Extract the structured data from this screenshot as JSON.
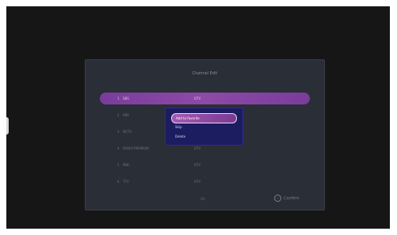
{
  "panel": {
    "title": "Channel Edit",
    "channels": [
      {
        "num": "1",
        "name": "SBS",
        "type": "DTV",
        "selected": true
      },
      {
        "num": "2",
        "name": "KBS",
        "type": "DTV",
        "selected": false
      },
      {
        "num": "3",
        "name": "NCTV",
        "type": "DTV",
        "selected": false
      },
      {
        "num": "4",
        "name": "RADIO PREMIUM",
        "type": "DTV",
        "selected": false
      },
      {
        "num": "5",
        "name": "MBC",
        "type": "DTV",
        "selected": false
      },
      {
        "num": "6",
        "name": "TTV",
        "type": "DTV",
        "selected": false
      }
    ],
    "footer_center": "OK",
    "confirm_label": "Confirm"
  },
  "context_menu": {
    "items": [
      "Add to favorite",
      "Skip",
      "Delete"
    ],
    "focused_index": 0
  },
  "colors": {
    "background": "#161617",
    "panel": "#2a2e37",
    "selected_row": "#8d4aa6",
    "menu": "#1c1d60"
  },
  "icons": {
    "confirm": "circle-ok-icon"
  }
}
